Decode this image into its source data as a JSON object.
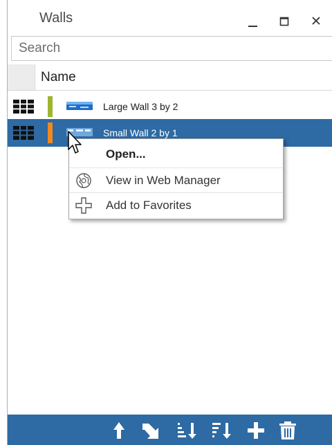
{
  "window": {
    "title": "Walls",
    "buttons": {
      "minimize": "minimize",
      "maximize": "maximize",
      "close": "close"
    }
  },
  "search": {
    "placeholder": "Search",
    "value": ""
  },
  "list": {
    "column_header": "Name",
    "rows": [
      {
        "label": "Large Wall 3 by 2",
        "color": "#9fb52e",
        "selected": false,
        "icons": [
          "grid-layout-icon",
          "wall-thumbnail-icon"
        ]
      },
      {
        "label": "Small Wall 2 by 1",
        "color": "#f0891e",
        "selected": true,
        "icons": [
          "grid-layout-icon",
          "wall-thumbnail-icon"
        ]
      }
    ]
  },
  "context_menu": {
    "items": [
      {
        "label": "Open...",
        "icon": ""
      },
      {
        "label": "View in Web Manager",
        "icon": "globe-icon"
      },
      {
        "label": "Add to Favorites",
        "icon": "plus-outline-icon"
      }
    ]
  },
  "toolbar": {
    "buttons": [
      "up-arrow-icon",
      "redo-arrow-icon",
      "sort-ascending-icon",
      "sort-descending-icon",
      "add-icon",
      "delete-icon"
    ]
  },
  "colors": {
    "selection": "#2e6aa3",
    "toolbar": "#2e6aa3",
    "row1_bar": "#9fb52e",
    "row2_bar": "#f0891e"
  }
}
